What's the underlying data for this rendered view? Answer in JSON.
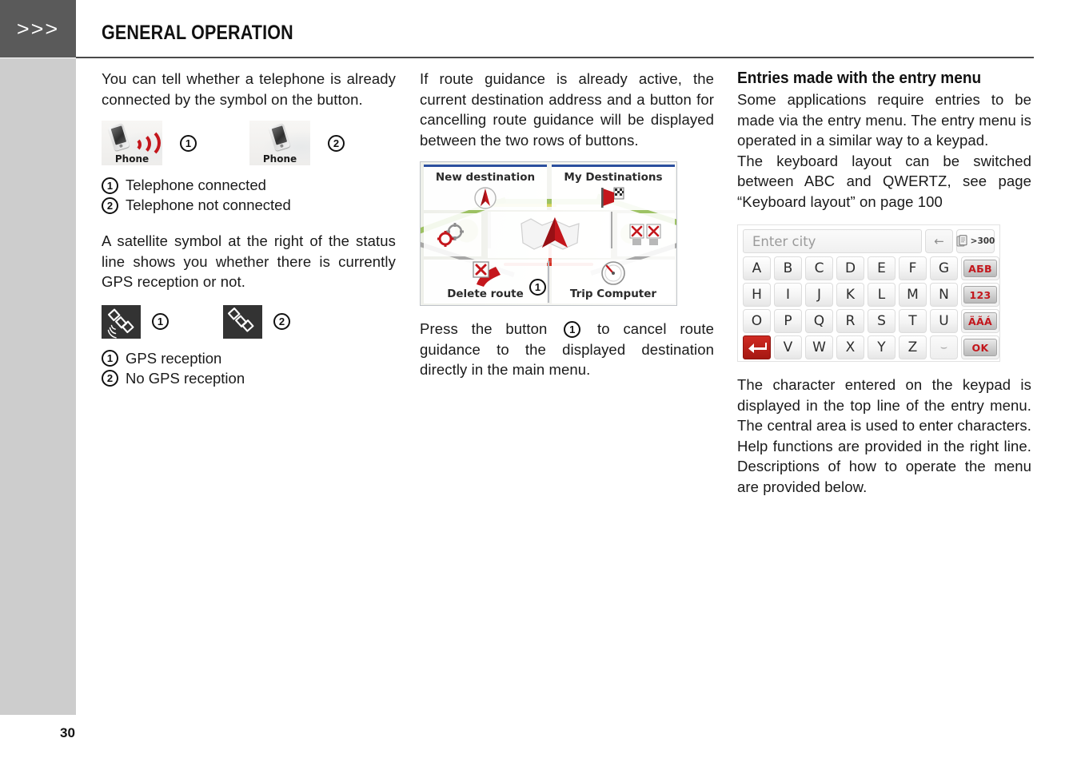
{
  "header": {
    "chevrons": ">>>",
    "title": "GENERAL OPERATION"
  },
  "page_number": "30",
  "column1": {
    "paragraph1": "You can tell whether a telephone is already connected by the symbol on the button.",
    "phone_figures": [
      {
        "label": "Phone",
        "callout": "1",
        "state": "connected"
      },
      {
        "label": "Phone",
        "callout": "2",
        "state": "not-connected"
      }
    ],
    "phone_legend": [
      {
        "callout": "1",
        "text": "Telephone connected"
      },
      {
        "callout": "2",
        "text": "Telephone not connected"
      }
    ],
    "paragraph2": "A satellite symbol at the right of the status line shows you whether there is currently GPS reception or not.",
    "gps_figures": [
      {
        "callout": "1",
        "state": "reception"
      },
      {
        "callout": "2",
        "state": "no-reception"
      }
    ],
    "gps_legend": [
      {
        "callout": "1",
        "text": "GPS reception"
      },
      {
        "callout": "2",
        "text": "No GPS reception"
      }
    ]
  },
  "column2": {
    "paragraph1": "If route guidance is already active, the current destination address and a button for cancelling route guidance will be displayed between the two rows of buttons.",
    "navmenu": {
      "top_left_label": "New destination",
      "top_right_label": "My Destinations",
      "bottom_left_label": "Delete route",
      "bottom_right_label": "Trip Computer",
      "delete_route_callout": "1"
    },
    "paragraph2_before": "Press the button",
    "paragraph2_callout": "1",
    "paragraph2_after": "to cancel route guidance to the displayed destination directly in the main menu."
  },
  "column3": {
    "heading": "Entries made with the entry menu",
    "paragraph1": "Some applications require entries to be made via the entry menu. The entry menu is operated in a similar way to a keypad.",
    "paragraph2": "The keyboard layout can be switched between ABC and QWERTZ, see page “Keyboard layout” on page 100",
    "keyboard": {
      "input_placeholder": "Enter city",
      "backspace_glyph": "←",
      "results_badge": ">300",
      "rows": [
        [
          "A",
          "B",
          "C",
          "D",
          "E",
          "F",
          "G"
        ],
        [
          "H",
          "I",
          "J",
          "K",
          "L",
          "M",
          "N"
        ],
        [
          "O",
          "P",
          "Q",
          "R",
          "S",
          "T",
          "U"
        ],
        [
          "V",
          "W",
          "X",
          "Y",
          "Z",
          "⌣"
        ]
      ],
      "side_keys": [
        "АБВ",
        "123",
        "ÄÃÁ",
        "OK"
      ],
      "enter_key": "return-arrow"
    },
    "paragraph3": "The character entered on the keypad is displayed in the top line of the entry menu. The central area is used to enter characters. Help functions are provided in the right line. Descriptions of how to operate the menu are provided below."
  },
  "colors": {
    "header_tab_bg": "#5a5a5a",
    "side_band_bg": "#cdcdcd",
    "accent_red": "#c3161c",
    "nav_blue": "#2b4f9e"
  }
}
